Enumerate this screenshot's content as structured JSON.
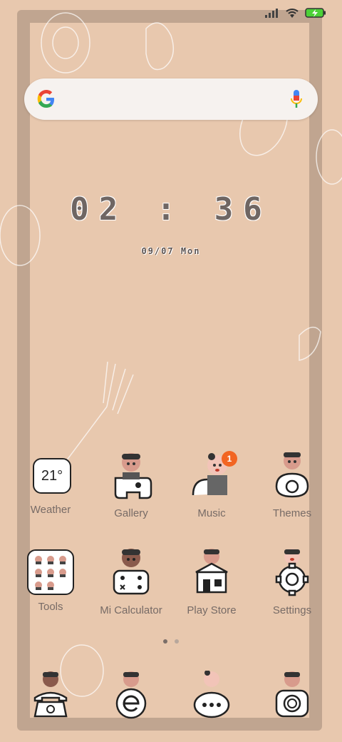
{
  "status_bar": {
    "signal_icon": "signal-icon",
    "wifi_icon": "wifi-icon",
    "battery_icon": "battery-charging-icon"
  },
  "search": {
    "logo": "google-logo",
    "mic_icon": "mic-icon"
  },
  "clock": {
    "time": "02 : 36",
    "date": "09/07 Mon"
  },
  "apps": {
    "row1": [
      {
        "label": "Weather",
        "icon": "weather-icon",
        "temp": "21°"
      },
      {
        "label": "Gallery",
        "icon": "gallery-icon"
      },
      {
        "label": "Music",
        "icon": "music-icon",
        "badge": "1"
      },
      {
        "label": "Themes",
        "icon": "themes-icon"
      }
    ],
    "row2": [
      {
        "label": "Tools",
        "icon": "tools-folder-icon"
      },
      {
        "label": "Mi Calculator",
        "icon": "calculator-icon"
      },
      {
        "label": "Play Store",
        "icon": "play-store-icon"
      },
      {
        "label": "Settings",
        "icon": "settings-icon"
      }
    ],
    "dock": [
      {
        "icon": "phone-icon"
      },
      {
        "icon": "browser-icon"
      },
      {
        "icon": "messages-icon"
      },
      {
        "icon": "camera-icon"
      }
    ]
  },
  "pager": {
    "pages": 2,
    "current": 1
  },
  "colors": {
    "wallpaper": "#e8c8ae",
    "frame": "#b39a86",
    "badge": "#f26522",
    "label": "#776b66"
  }
}
